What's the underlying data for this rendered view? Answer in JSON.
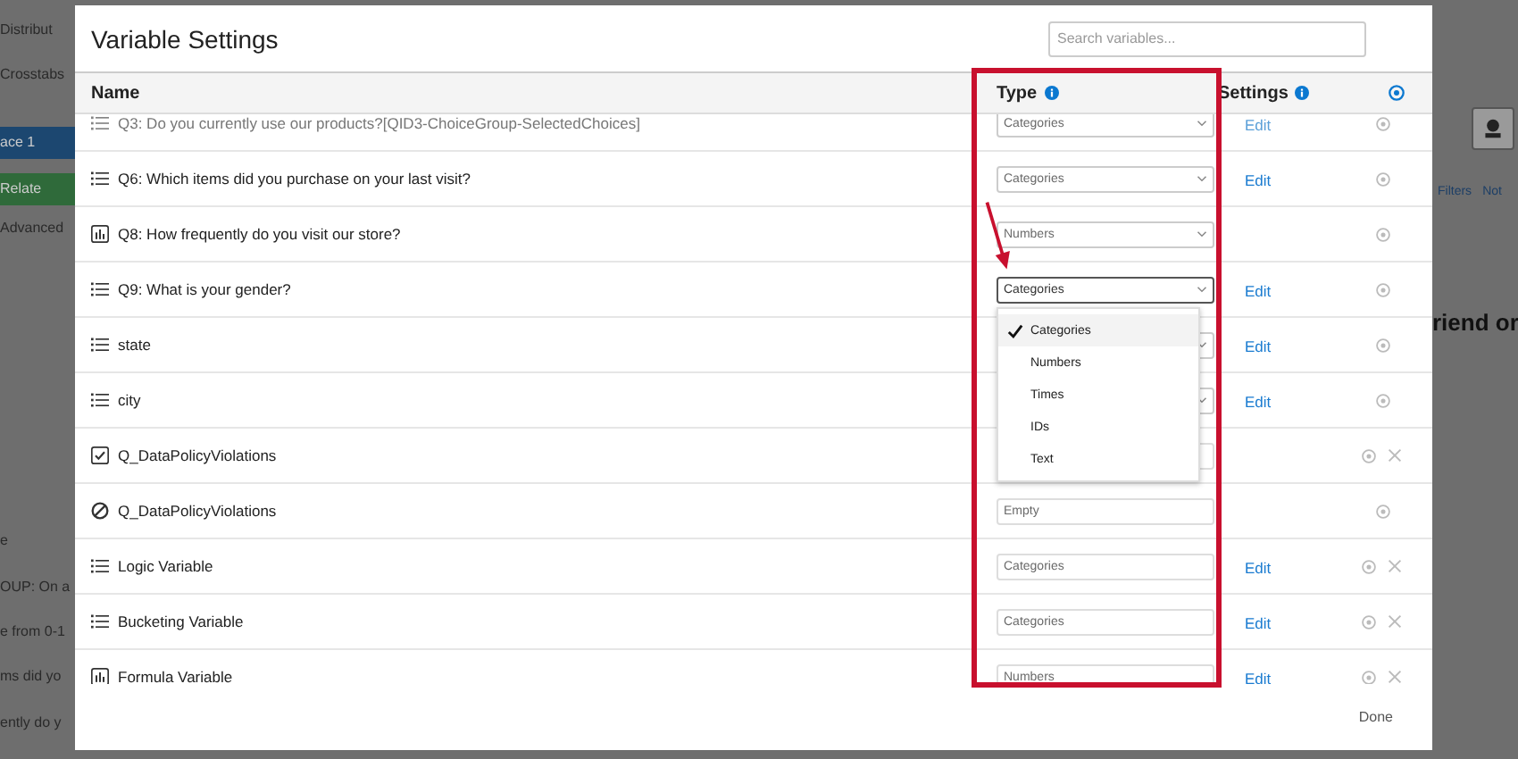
{
  "background": {
    "left_texts": [
      "Distribut",
      "Crosstabs",
      "ace 1",
      "Relate",
      "Advanced",
      "e",
      "OUP: On a",
      "e from 0-1",
      "ms did yo",
      "ently do y"
    ],
    "right_tabs": [
      "Filters",
      "Not"
    ],
    "right_heading": "riend or"
  },
  "dialog": {
    "title": "Variable Settings",
    "search": {
      "placeholder": "Search variables..."
    },
    "columns": {
      "name": "Name",
      "type": "Type",
      "settings": "Settings"
    },
    "rows": [
      {
        "name": "Q3: Do you currently use our products?[QID3-ChoiceGroup-SelectedChoices]",
        "kind": "list",
        "faded": true,
        "type": {
          "kind": "select",
          "value": "Categories",
          "focused": false
        },
        "edit": "Edit",
        "removable": false
      },
      {
        "name": "Q6: Which items did you purchase on your last visit?",
        "kind": "list",
        "faded": false,
        "type": {
          "kind": "select",
          "value": "Categories",
          "focused": false
        },
        "edit": "Edit",
        "removable": false
      },
      {
        "name": "Q8: How frequently do you visit our store?",
        "kind": "chart",
        "faded": false,
        "type": {
          "kind": "select",
          "value": "Numbers",
          "focused": false
        },
        "removable": false
      },
      {
        "name": "Q9: What is your gender?",
        "kind": "list",
        "faded": false,
        "type": {
          "kind": "select",
          "value": "Categories",
          "focused": true
        },
        "edit": "Edit",
        "removable": false
      },
      {
        "name": "state",
        "kind": "list",
        "faded": false,
        "type": {
          "kind": "select",
          "focused": false
        },
        "edit": "Edit",
        "removable": false
      },
      {
        "name": "city",
        "kind": "list",
        "faded": false,
        "type": {
          "kind": "select",
          "focused": false
        },
        "edit": "Edit",
        "removable": false
      },
      {
        "name": "Q_DataPolicyViolations",
        "kind": "checkbox",
        "faded": false,
        "type": {
          "kind": "text"
        },
        "removable": true
      },
      {
        "name": "Q_DataPolicyViolations",
        "kind": "blocked",
        "faded": false,
        "type": {
          "kind": "text",
          "value": "Empty"
        },
        "removable": false
      },
      {
        "name": "Logic Variable",
        "kind": "list",
        "faded": false,
        "type": {
          "kind": "text",
          "value": "Categories"
        },
        "edit": "Edit",
        "removable": true
      },
      {
        "name": "Bucketing Variable",
        "kind": "list",
        "faded": false,
        "type": {
          "kind": "text",
          "value": "Categories"
        },
        "edit": "Edit",
        "removable": true
      },
      {
        "name": "Formula Variable",
        "kind": "chart",
        "faded": false,
        "type": {
          "kind": "text",
          "value": "Numbers"
        },
        "edit": "Edit",
        "removable": true
      }
    ],
    "dropdown": {
      "options": [
        {
          "label": "Categories",
          "selected": true
        },
        {
          "label": "Numbers",
          "selected": false
        },
        {
          "label": "Times",
          "selected": false
        },
        {
          "label": "IDs",
          "selected": false
        },
        {
          "label": "Text",
          "selected": false
        }
      ]
    },
    "done": "Done"
  }
}
